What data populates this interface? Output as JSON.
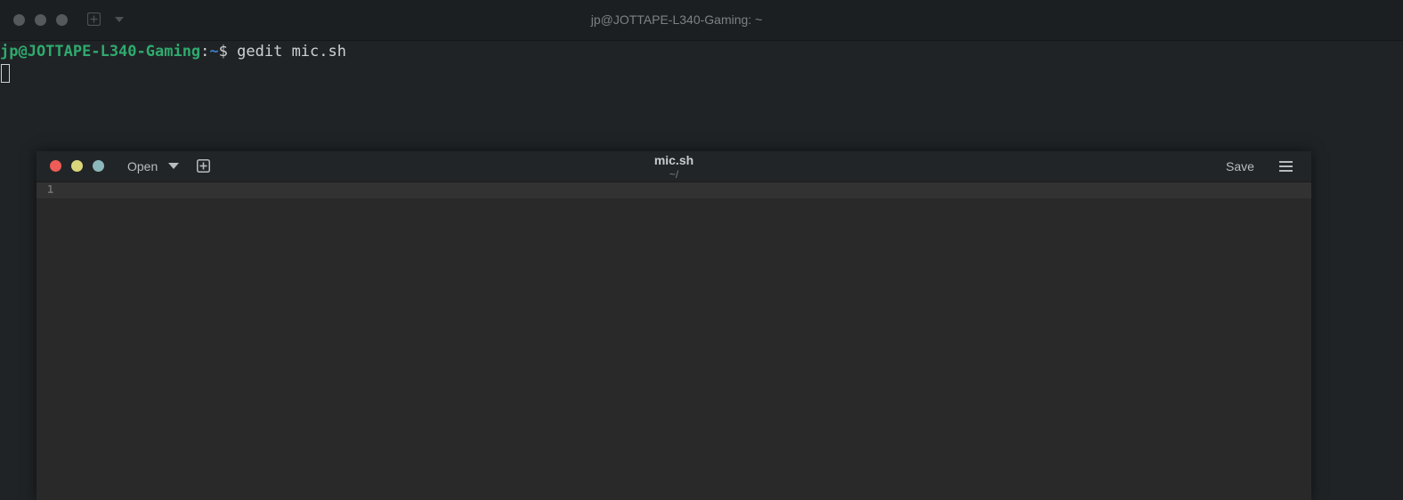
{
  "terminal": {
    "title": "jp@JOTTAPE-L340-Gaming: ~",
    "prompt_user": "jp@JOTTAPE-L340-Gaming",
    "prompt_colon": ":",
    "prompt_dir": "~",
    "prompt_symbol": "$ ",
    "command": "gedit mic.sh",
    "window_controls": [
      "close",
      "minimize",
      "maximize"
    ],
    "icons": {
      "new_tab": "new-tab-icon",
      "dropdown": "chevron-down-icon"
    }
  },
  "gedit": {
    "title": "mic.sh",
    "subtitle": "~/",
    "open_label": "Open",
    "save_label": "Save",
    "line_numbers": [
      "1"
    ],
    "colors": {
      "close": "#ed5c56",
      "minimize": "#dcd67a",
      "maximize": "#8bb8bc"
    },
    "icons": {
      "open_dropdown": "chevron-down-icon",
      "new_document": "new-document-icon",
      "menu": "hamburger-menu-icon"
    }
  }
}
